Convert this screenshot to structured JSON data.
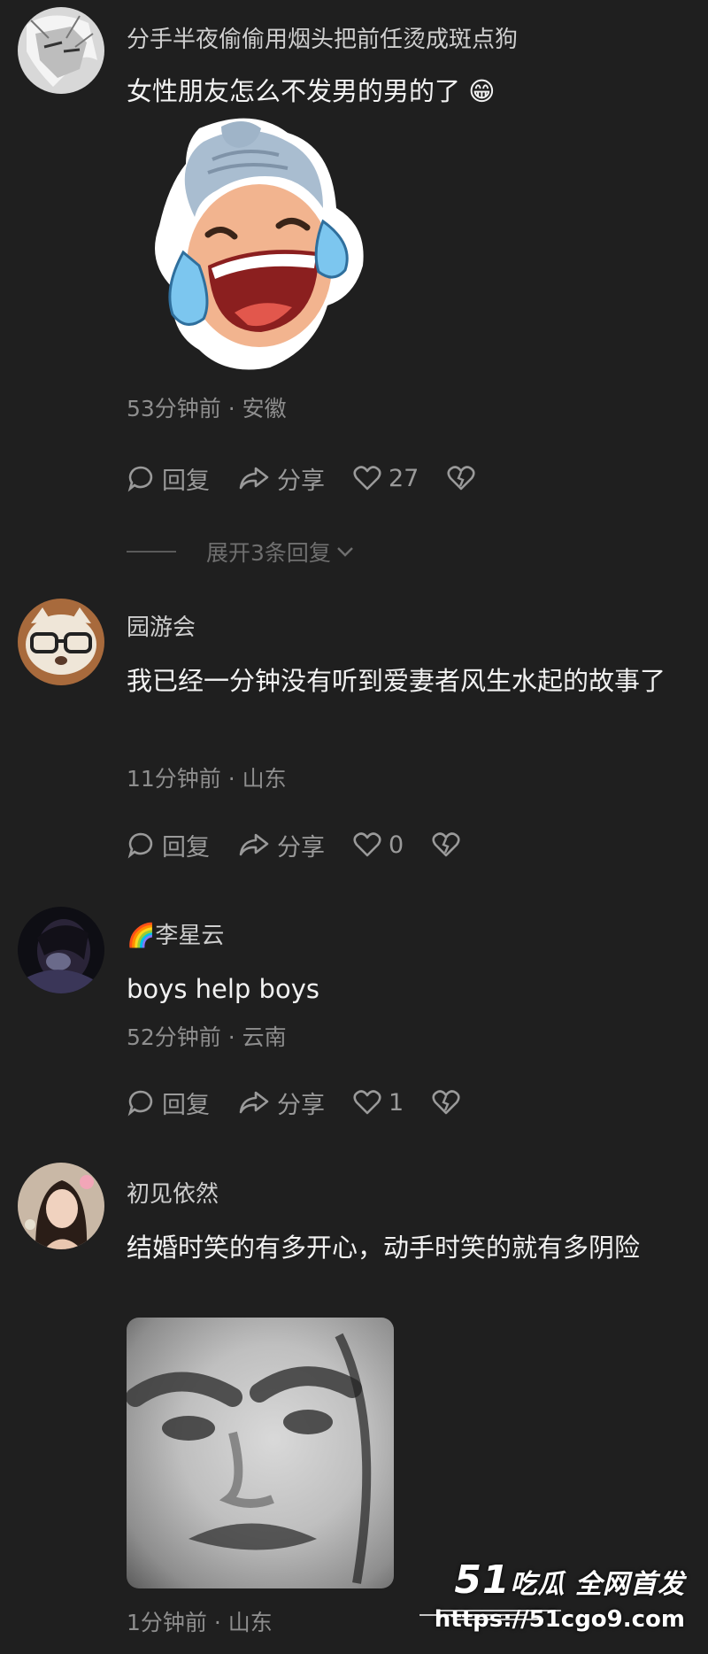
{
  "comments": [
    {
      "username": "分手半夜偷偷用烟头把前任烫成斑点狗",
      "text": "女性朋友怎么不发男的男的了",
      "emoji": "😁",
      "sticker": "crying-laughing-sticker",
      "meta": "53分钟前 · 安徽",
      "reply_label": "回复",
      "share_label": "分享",
      "likes": "27",
      "expand_label": "展开3条回复"
    },
    {
      "username": "园游会",
      "text": "我已经一分钟没有听到爱妻者风生水起的故事了",
      "meta": "11分钟前 · 山东",
      "reply_label": "回复",
      "share_label": "分享",
      "likes": "0"
    },
    {
      "username_emoji": "🌈",
      "username": "李星云",
      "text": "boys help boys",
      "meta": "52分钟前 · 云南",
      "reply_label": "回复",
      "share_label": "分享",
      "likes": "1"
    },
    {
      "username": "初见依然",
      "text": "结婚时笑的有多开心，动手时笑的就有多阴险",
      "image": "angry-face-meme",
      "meta": "1分钟前 · 山东"
    }
  ],
  "watermark": {
    "brand_num": "51",
    "brand_text": "吃瓜 全网首发",
    "url": "https://51cgo9.com"
  },
  "colors": {
    "background": "#1f1f1f",
    "text": "#f2f2f2",
    "secondary": "#8e8e8e"
  }
}
